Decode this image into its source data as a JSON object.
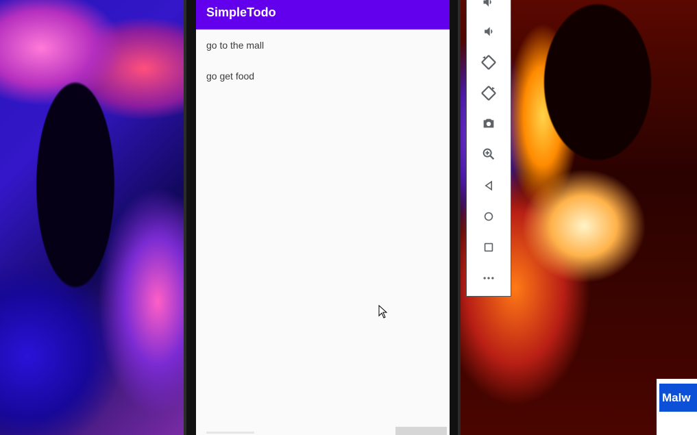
{
  "app": {
    "title": "SimpleTodo",
    "items": [
      {
        "text": "go to the mall"
      },
      {
        "text": "go get food"
      }
    ]
  },
  "emulator_toolbar": {
    "tools": [
      {
        "icon": "volume-up-icon"
      },
      {
        "icon": "volume-down-icon"
      },
      {
        "icon": "rotate-left-icon"
      },
      {
        "icon": "rotate-right-icon"
      },
      {
        "icon": "camera-icon"
      },
      {
        "icon": "zoom-icon"
      },
      {
        "icon": "back-icon"
      },
      {
        "icon": "home-icon"
      },
      {
        "icon": "overview-icon"
      },
      {
        "icon": "more-icon"
      }
    ]
  },
  "overlay": {
    "badge_text": "Malw"
  },
  "colors": {
    "app_bar": "#6200ee",
    "screen_bg": "#fafafa",
    "toolbar_icon": "#5f6368",
    "badge": "#0d50d8"
  }
}
